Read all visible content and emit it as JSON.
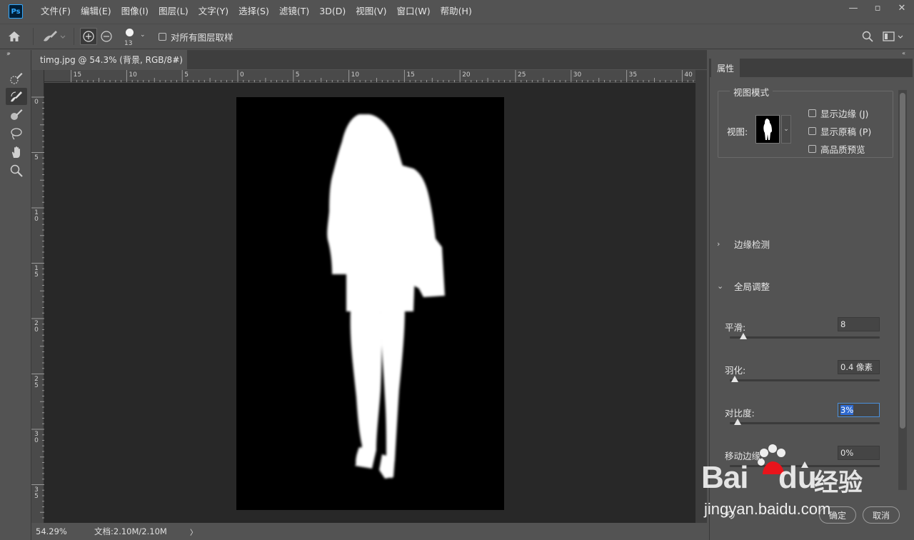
{
  "app": {
    "logo": "Ps"
  },
  "menu": [
    "文件(F)",
    "编辑(E)",
    "图像(I)",
    "图层(L)",
    "文字(Y)",
    "选择(S)",
    "滤镜(T)",
    "3D(D)",
    "视图(V)",
    "窗口(W)",
    "帮助(H)"
  ],
  "window_controls": {
    "minimize": "—",
    "restore": "▫",
    "close": "✕"
  },
  "options_bar": {
    "brush_size": "13",
    "sample_all_layers": "对所有图层取样",
    "sample_all_checked": false
  },
  "document": {
    "tab_title": "timg.jpg @ 54.3% (背景, RGB/8#)",
    "tab_close": "×",
    "ruler_top": [
      "15",
      "10",
      "5",
      "0",
      "5",
      "10",
      "15",
      "20",
      "25",
      "30",
      "35",
      "40"
    ],
    "ruler_left": [
      "0",
      "5",
      "10",
      "15",
      "20",
      "25",
      "30",
      "35"
    ]
  },
  "status_bar": {
    "zoom": "54.29%",
    "doc_info": "文档:2.10M/2.10M",
    "arrow": "〉"
  },
  "properties_panel": {
    "tab": "属性",
    "view_mode": {
      "title": "视图模式",
      "view_label": "视图:",
      "options": [
        {
          "label": "显示边缘 (J)",
          "checked": false
        },
        {
          "label": "显示原稿 (P)",
          "checked": false
        },
        {
          "label": "高品质预览",
          "checked": false
        }
      ]
    },
    "edge_detection": "边缘检测",
    "global_refine": "全局调整",
    "sliders": {
      "smooth": {
        "label": "平滑:",
        "value": "8",
        "level": 0.07
      },
      "feather": {
        "label": "羽化:",
        "value": "0.4 像素",
        "level": 0.01
      },
      "contrast": {
        "label": "对比度:",
        "value": "3%",
        "level": 0.03
      },
      "shift_edge": {
        "label": "移动边缘:",
        "value": "0%",
        "level": 0.5
      }
    },
    "ok_button": "确定",
    "cancel_button": "取消"
  },
  "watermark": {
    "brand_left": "Bai",
    "brand_right": "du",
    "brand_cn": "经验",
    "url": "jingyan.baidu.com"
  }
}
